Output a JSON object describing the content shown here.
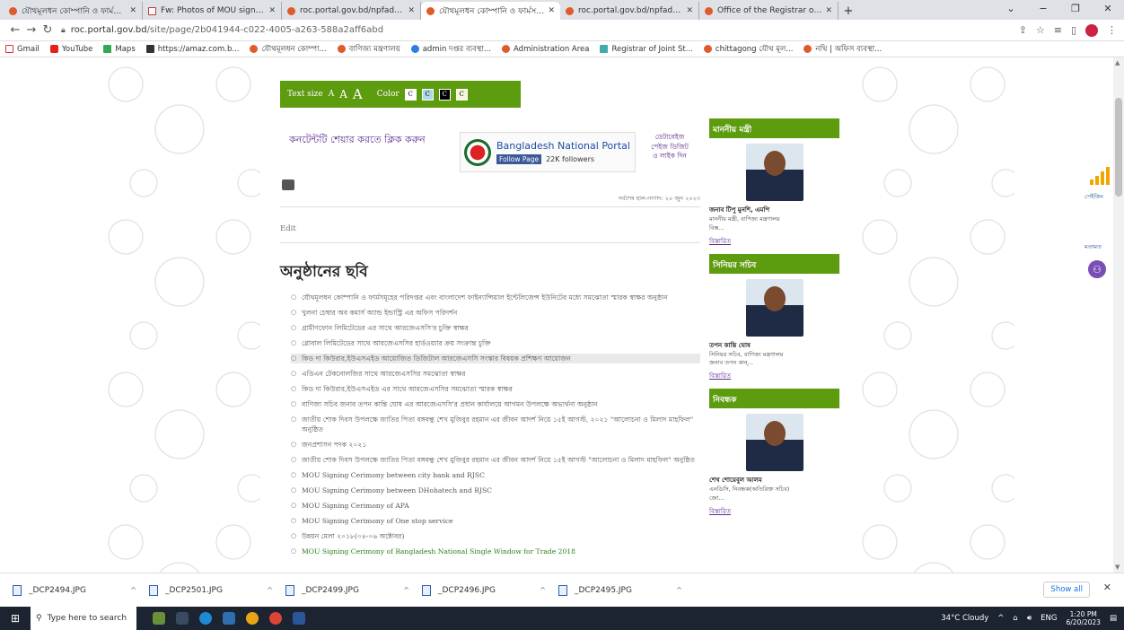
{
  "browser": {
    "tabs": [
      {
        "title": "যৌথমূলধন কোম্পানি ও ফার্মসমূহের পরিদপ্তর",
        "active": false,
        "icon": "site-favicon"
      },
      {
        "title": "Fw: Photos of MOU signing ceremony",
        "active": false,
        "icon": "gmail-favicon"
      },
      {
        "title": "roc.portal.gov.bd/npfadmin/public",
        "active": false,
        "icon": "site-favicon"
      },
      {
        "title": "যৌথমূলধন কোম্পানি ও ফার্মসমূহের পরিদপ্তর",
        "active": true,
        "icon": "site-favicon"
      },
      {
        "title": "roc.portal.gov.bd/npfadmin/public",
        "active": false,
        "icon": "site-favicon"
      },
      {
        "title": "Office of the Registrar of Joint St...",
        "active": false,
        "icon": "site-favicon"
      }
    ],
    "new_tab": "+",
    "window_controls": {
      "dropdown": "⌄",
      "minimize": "−",
      "restore": "❐",
      "close": "✕"
    },
    "url_host": "roc.portal.gov.bd",
    "url_path": "/site/page/2b041944-c022-4005-a263-588a2aff6abd",
    "bookmarks": [
      {
        "label": "Gmail",
        "icon": "gmail-icon"
      },
      {
        "label": "YouTube",
        "icon": "youtube-icon"
      },
      {
        "label": "Maps",
        "icon": "maps-icon"
      },
      {
        "label": "https://amaz.com.b...",
        "icon": "amazon-icon"
      },
      {
        "label": "যৌথমূলধন কোম্পা...",
        "icon": "site-icon"
      },
      {
        "label": "বাণিজ্য মন্ত্রণালয়",
        "icon": "site-icon"
      },
      {
        "label": "admin দপ্তর ব্যবস্থা...",
        "icon": "site-icon"
      },
      {
        "label": "Administration Area",
        "icon": "site-icon"
      },
      {
        "label": "Registrar of Joint St...",
        "icon": "site-icon"
      },
      {
        "label": "chittagong যৌথ মূল...",
        "icon": "site-icon"
      },
      {
        "label": "নথি | অফিস ব্যবস্থা...",
        "icon": "site-icon"
      }
    ]
  },
  "accessibility": {
    "text_size_label": "Text size",
    "sizes": [
      "A",
      "A",
      "A"
    ],
    "color_label": "Color",
    "swatches": [
      "C",
      "C",
      "C",
      "C"
    ]
  },
  "share_text": "কনটেন্টটি শেয়ার করতে ক্লিক করুন",
  "portal_widget": {
    "name": "Bangladesh National Portal",
    "follow_label": "Follow Page",
    "followers": "22K followers"
  },
  "portal_link": "ডেটাবেইজ পেইজ ডিজিট ও লাইক দিন",
  "last_updated": "সর্বশেষ হাল-নাগাদ: ২০ জুন ২০২৩",
  "edit_label": "Edit",
  "page_title": "অনুষ্ঠানের ছবি",
  "events": [
    "যৌথমূলধন কোম্পানি ও ফার্মসমূহের পরিদপ্তর এবং বাংলাদেশ ফাইন্যান্সিয়াল ইন্টেলিজেন্স ইউনিটের মধ্যে সমঝোতা স্মারক স্বাক্ষর অনুষ্ঠান",
    "খুলনা চেম্বার অব কমার্স অ্যান্ড ইন্ডাস্ট্রি এর অফিস পরিদর্শন",
    "গ্রামীণফোন লিমিটেডের এর সাথে আরজেএসসি'র চুক্তি স্বাক্ষর",
    "গ্লোবাল লিমিটেডের সাথে আরজেএসসির হার্ডওয়্যার ক্রয় সংক্রান্ত চুক্তি",
    "কিড দা কিউরার,ইউএসএইড আয়োজিত ডিজিটাল আরজেএসসি সংস্কার বিষয়ক প্রশিক্ষণ আয়োজন",
    "এডিএন টেকনোলজির সাথে আরজেএসসির সমঝোতা স্বাক্ষর",
    "কিড দা কিউরার,ইউএসএইড এর সাথে আরজেএসসির সমঝোতা স্মারক স্বাক্ষর",
    "বাণিজ্য সচিব জনাব তপন কান্তি ঘোষ এর আরজেএসসি'র প্রধান কার্যালয়ে আগমন উপলক্ষে অভ্যর্থনা অনুষ্ঠান",
    "জাতীয় শোক দিবস উপলক্ষে জাতির পিতা বঙ্গবন্ধু শেখ মুজিবুর রহমান এর জীবন আদর্শ নিয়ে ১৫ই আগস্ট, ২০২১ \"আলোচনা ও মিলাদ মাহফিল\" অনুষ্ঠিত",
    "জনপ্রশাসন পদক ২০২১",
    "জাতীয় শোক দিবস উপলক্ষে জাতির পিতা বঙ্গবন্ধু শেখ মুজিবুর রহমান এর জীবন আদর্শ নিয়ে ১৫ই আগস্ট \"আলোচনা ও মিলাদ মাহফিল\" অনুষ্ঠিত",
    "MOU Signing Cerimony between city bank and RJSC",
    "MOU Signing Cerimony between DHohatech and RJSC",
    "MOU Signing Cerimony of APA",
    "MOU Signing Cerimony of One stop service",
    "উন্নয়ন মেলা ২০১৮(০৪-০৬ অক্টোবর)",
    "MOU Signing Cerimony of Bangladesh National Single Window for Trade 2018"
  ],
  "sidebar": [
    {
      "heading": "মাননীয় মন্ত্রী",
      "name": "জনাব টিপু মুনশি, এমপি",
      "desc1": "মাননীয় মন্ত্রী, বাণিজ্য মন্ত্রণালয়",
      "desc2": "বিস্ত...",
      "details": "বিস্তারিত"
    },
    {
      "heading": "সিনিয়র সচিব",
      "name": "তপন কান্তি ঘোষ",
      "desc1": "সিনিয়র সচিব, বাণিজ্য মন্ত্রণালয়",
      "desc2": "জনাব তপন কান্...",
      "details": "বিস্তারিত"
    },
    {
      "heading": "নিবন্ধক",
      "name": "শেখ শোয়েবুল আলম",
      "desc1": "এনডিসি, নিবন্ধক(অতিরিক্ত সচিব)",
      "desc2": "জো...",
      "details": "বিস্তারিত"
    }
  ],
  "floating": {
    "rating_label": "পেইজিং",
    "feedback_label": "মতামত"
  },
  "downloads": [
    "_DCP2494.JPG",
    "_DCP2501.JPG",
    "_DCP2499.JPG",
    "_DCP2496.JPG",
    "_DCP2495.JPG"
  ],
  "downloads_show_all": "Show all",
  "taskbar": {
    "search_placeholder": "Type here to search",
    "weather": "34°C Cloudy",
    "lang": "ENG",
    "time": "1:20 PM",
    "date": "6/20/2023"
  },
  "colors": {
    "accent_green": "#5d9b0f",
    "link_purple": "#5b2b8a"
  }
}
